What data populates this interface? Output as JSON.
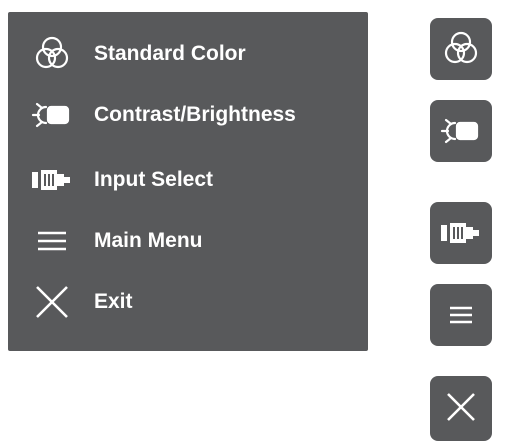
{
  "osd_menu": {
    "items": [
      {
        "label": "Standard Color",
        "icon": "color-circles-icon"
      },
      {
        "label": "Contrast/Brightness",
        "icon": "brightness-icon"
      },
      {
        "label": "Input Select",
        "icon": "input-select-icon"
      },
      {
        "label": "Main Menu",
        "icon": "hamburger-menu-icon"
      },
      {
        "label": "Exit",
        "icon": "close-icon"
      }
    ]
  },
  "side_buttons": [
    {
      "icon": "color-circles-icon"
    },
    {
      "icon": "brightness-icon"
    },
    {
      "icon": "input-select-icon"
    },
    {
      "icon": "hamburger-menu-icon"
    },
    {
      "icon": "close-icon"
    }
  ],
  "colors": {
    "panel_background": "#58595b",
    "text": "#ffffff",
    "page_background": "#ffffff"
  }
}
